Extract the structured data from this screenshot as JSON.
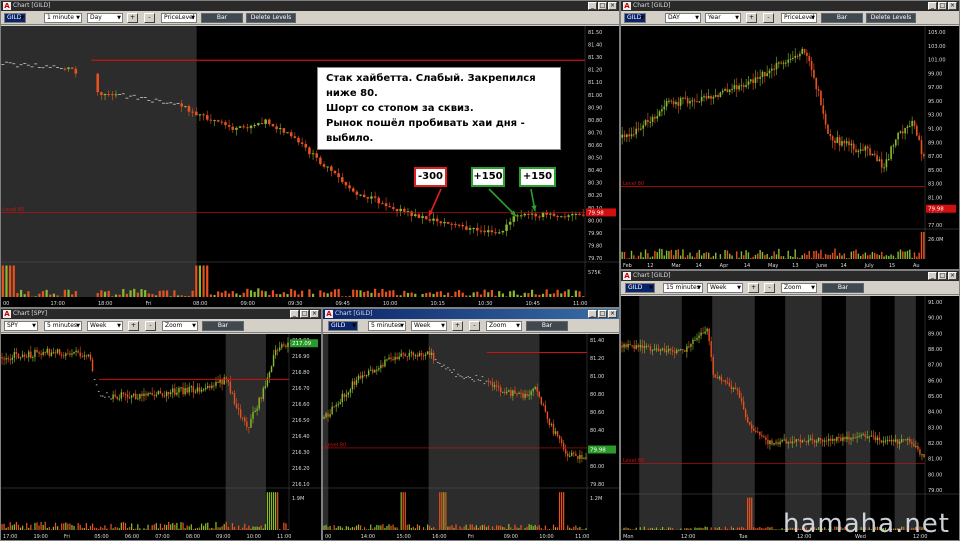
{
  "windows": {
    "w1": {
      "title": "Chart [GILD]",
      "symbol": "GILD",
      "interval": "1 minute",
      "range": "Day",
      "mode": "PriceLevel",
      "bar_label": "Bar",
      "delete_label": "Delete Levels",
      "plus": "+",
      "minus": "-",
      "yticks": [
        "81.50",
        "81.40",
        "81.30",
        "81.20",
        "81.10",
        "81.00",
        "80.90",
        "80.80",
        "80.70",
        "80.60",
        "80.50",
        "80.40",
        "80.30",
        "80.20",
        "80.10",
        "80.00",
        "79.90",
        "79.80",
        "79.70"
      ],
      "xticks": [
        "00",
        "17:00",
        "18:00",
        "Fri",
        "08:00",
        "09:00",
        "09:30",
        "09:45",
        "10:00",
        "10:15",
        "10:30",
        "10:45",
        "11:00"
      ],
      "level_label": "Level 80",
      "price_tag": "79.98",
      "volume_label": "575K"
    },
    "w2": {
      "title": "Chart [GILD]",
      "symbol": "GILD",
      "range": "DAY",
      "period": "Year",
      "mode": "PriceLevel",
      "bar_label": "Bar",
      "delete_label": "Delete Levels",
      "plus": "+",
      "minus": "-",
      "yticks": [
        "105.00",
        "103.00",
        "101.00",
        "99.00",
        "97.00",
        "95.00",
        "93.00",
        "91.00",
        "89.00",
        "87.00",
        "85.00",
        "83.00",
        "81.00",
        "79.00",
        "77.00"
      ],
      "xticks": [
        "Feb",
        "12",
        "Mar",
        "14",
        "Apr",
        "14",
        "May",
        "13",
        "June",
        "14",
        "July",
        "15",
        "Au"
      ],
      "level_label": "Level 80",
      "price_tag": "79.98",
      "volume_label": "26.0M"
    },
    "w3": {
      "title": "Chart [SPY]",
      "symbol": "SPY",
      "interval": "5 minutes",
      "range": "Week",
      "zoom": "Zoom",
      "bar_label": "Bar",
      "plus": "+",
      "minus": "-",
      "yticks": [
        "217.00",
        "216.90",
        "216.80",
        "216.70",
        "216.60",
        "216.50",
        "216.40",
        "216.30",
        "216.20",
        "216.10"
      ],
      "xticks": [
        "17:00",
        "19:00",
        "Fri",
        "05:00",
        "06:00",
        "07:00",
        "08:00",
        "09:00",
        "10:00",
        "11:00"
      ],
      "price_tag": "217.09",
      "volume_label": "1.9M"
    },
    "w4": {
      "title": "Chart [GILD]",
      "symbol": "GILD",
      "interval": "5 minutes",
      "range": "Week",
      "zoom": "Zoom",
      "bar_label": "Bar",
      "plus": "+",
      "minus": "-",
      "yticks": [
        "81.40",
        "81.20",
        "81.00",
        "80.80",
        "80.60",
        "80.40",
        "80.20",
        "80.00",
        "79.80"
      ],
      "xticks": [
        "00",
        "14:00",
        "15:00",
        "16:00",
        "Fri",
        "09:00",
        "10:00",
        "11:00"
      ],
      "level_label": "Level 80",
      "price_tag": "79.98",
      "volume_label": "1.2M"
    },
    "w5": {
      "title": "Chart [GILD]",
      "symbol": "GILD",
      "interval": "15 minutes",
      "range": "Week",
      "zoom": "Zoom",
      "bar_label": "Bar",
      "plus": "+",
      "minus": "-",
      "yticks": [
        "91.00",
        "90.00",
        "89.00",
        "88.00",
        "87.00",
        "86.00",
        "85.00",
        "84.00",
        "83.00",
        "82.00",
        "81.00",
        "80.00",
        "79.00"
      ],
      "xticks": [
        "Mon",
        "12:00",
        "Tue",
        "12:00",
        "Wed",
        "12:00"
      ],
      "level_label": "Level 80"
    }
  },
  "annotation": {
    "lines": [
      "Стак хайбетта. Слабый. Закрепился ниже 80.",
      "Шорт со стопом за сквиз.",
      "Рынок пошёл пробивать хаи дня - выбило."
    ],
    "badges": [
      "-300",
      "+150",
      "+150"
    ]
  },
  "watermark": "hamaha.net",
  "colors": {
    "up": "#8ab92d",
    "down": "#e8521f",
    "level": "#cc1111",
    "arrow_red": "#e02020",
    "arrow_green": "#2aa12a"
  }
}
